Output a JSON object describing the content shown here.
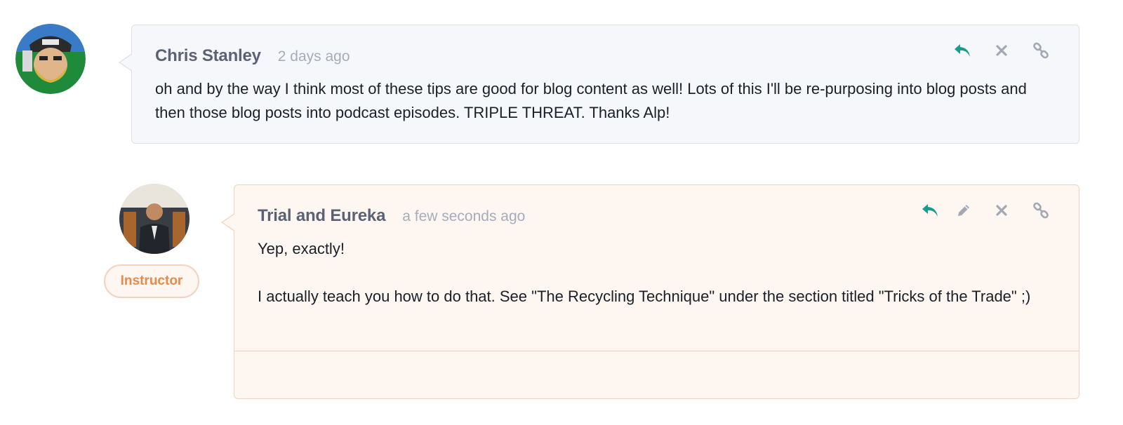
{
  "comments": [
    {
      "author": "Chris Stanley",
      "time": "2 days ago",
      "body": "oh and by the way I think most of these tips are good for blog content as well! Lots of this I'll be re-purposing into blog posts and then those blog posts into podcast episodes. TRIPLE THREAT. Thanks Alp!",
      "actions": [
        "reply-icon",
        "delete-icon",
        "link-icon"
      ]
    },
    {
      "author": "Trial and Eureka",
      "time": "a few seconds ago",
      "badge": "Instructor",
      "body_lines": [
        "Yep, exactly!",
        "I actually teach you how to do that. See \"The Recycling Technique\" under the section titled \"Tricks of the Trade\" ;)"
      ],
      "actions": [
        "reply-icon",
        "edit-icon",
        "delete-icon",
        "link-icon"
      ]
    }
  ],
  "colors": {
    "reply": "#1a9c8c",
    "icon_grey": "#a3a8b4",
    "instructor": "#e98a4a"
  }
}
